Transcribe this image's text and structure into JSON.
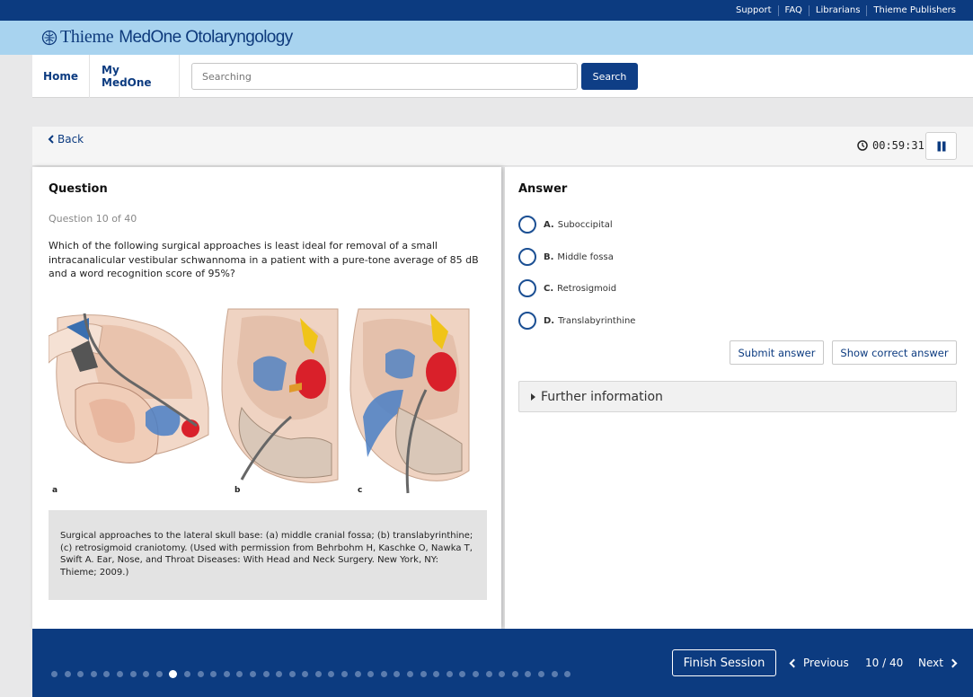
{
  "top_links": [
    "Support",
    "FAQ",
    "Librarians",
    "Thieme Publishers"
  ],
  "brand": {
    "thieme": "Thieme",
    "product": "MedOne Otolaryngology"
  },
  "nav": {
    "home": "Home",
    "my_medone": "My MedOne"
  },
  "search": {
    "placeholder": "Searching",
    "button": "Search"
  },
  "session": {
    "back": "Back",
    "timer": "00:59:31"
  },
  "question": {
    "heading": "Question",
    "number": "Question 10 of 40",
    "text": "Which of the following surgical approaches is least ideal for removal of a small intracanalicular vestibular schwannoma in a patient with a pure-tone average of 85 dB and a word recognition score of 95%?",
    "figure_labels": [
      "a",
      "b",
      "c"
    ],
    "caption": "Surgical approaches to the lateral skull base: (a) middle cranial fossa; (b) translabyrinthine; (c) retrosigmoid craniotomy. (Used with permission from Behrbohm H, Kaschke O, Nawka T, Swift A. Ear, Nose, and Throat Diseases: With Head and Neck Surgery. New York, NY: Thieme; 2009.)"
  },
  "answer": {
    "heading": "Answer",
    "options": [
      {
        "letter": "A.",
        "text": "Suboccipital"
      },
      {
        "letter": "B.",
        "text": "Middle fossa"
      },
      {
        "letter": "C.",
        "text": "Retrosigmoid"
      },
      {
        "letter": "D.",
        "text": "Translabyrinthine"
      }
    ],
    "submit": "Submit answer",
    "show_correct": "Show correct answer",
    "further": "Further information"
  },
  "footer": {
    "finish": "Finish Session",
    "previous": "Previous",
    "counter": "10 / 40",
    "next": "Next",
    "total_questions": 40,
    "current_question": 10
  },
  "colors": {
    "brand_dark": "#0c3b80",
    "brand_light": "#a8d3ef",
    "tumor": "#d9202a"
  }
}
